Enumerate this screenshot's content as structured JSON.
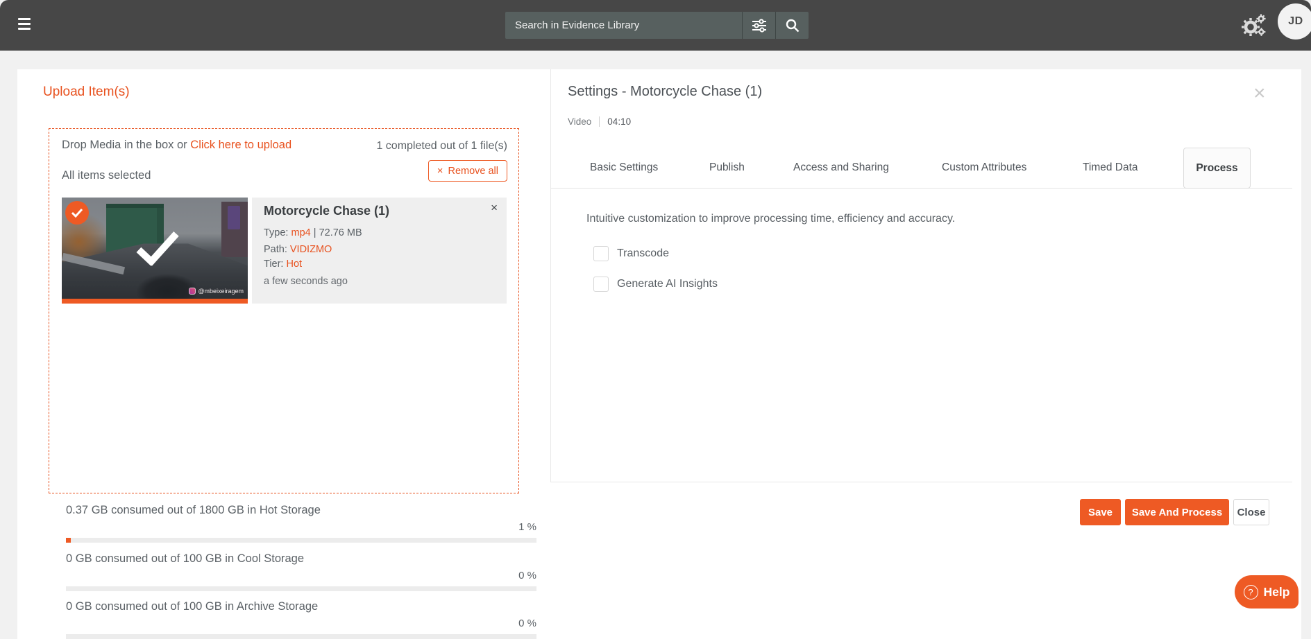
{
  "colors": {
    "accent": "#ee5a24",
    "accent_text": "#e8511e",
    "topbar": "#474747",
    "searchbox": "#57605f"
  },
  "topbar": {
    "search_placeholder": "Search in Evidence Library",
    "avatar_initials": "JD"
  },
  "upload_panel": {
    "title": "Upload Item(s)",
    "drop_text": "Drop Media in the box or",
    "upload_link": "Click here to upload",
    "progress_summary": "1 completed out of 1 file(s)",
    "selection_text": "All items selected",
    "remove_all_icon": "×",
    "remove_all_label": "Remove all",
    "item": {
      "title": "Motorcycle Chase (1)",
      "close_icon": "×",
      "type_label": "Type:",
      "type_value": "mp4",
      "separator": "|",
      "size": "72.76 MB",
      "path_label": "Path:",
      "path_value": "VIDIZMO",
      "tier_label": "Tier:",
      "tier_value": "Hot",
      "timestamp": "a few seconds ago",
      "watermark": "@mbeixeiragem"
    },
    "storage": [
      {
        "label": "0.37 GB consumed out of 1800 GB in Hot Storage",
        "percent_label": "1 %",
        "percent": 1
      },
      {
        "label": "0 GB consumed out of 100 GB in Cool Storage",
        "percent_label": "0 %",
        "percent": 0
      },
      {
        "label": "0 GB consumed out of 100 GB in Archive Storage",
        "percent_label": "0 %",
        "percent": 0
      }
    ]
  },
  "settings_panel": {
    "title": "Settings - Motorcycle Chase (1)",
    "close_icon": "×",
    "media_type": "Video",
    "duration": "04:10",
    "tabs": [
      {
        "label": "Basic Settings",
        "active": false
      },
      {
        "label": "Publish",
        "active": false
      },
      {
        "label": "Access and Sharing",
        "active": false
      },
      {
        "label": "Custom Attributes",
        "active": false
      },
      {
        "label": "Timed Data",
        "active": false
      },
      {
        "label": "Process",
        "active": true
      }
    ],
    "description": "Intuitive customization to improve processing time, efficiency and accuracy.",
    "checkboxes": [
      {
        "label": "Transcode",
        "checked": false
      },
      {
        "label": "Generate AI Insights",
        "checked": false
      }
    ],
    "buttons": {
      "save": "Save",
      "save_and_process": "Save And Process",
      "close": "Close"
    }
  },
  "help": {
    "icon": "?",
    "label": "Help"
  }
}
